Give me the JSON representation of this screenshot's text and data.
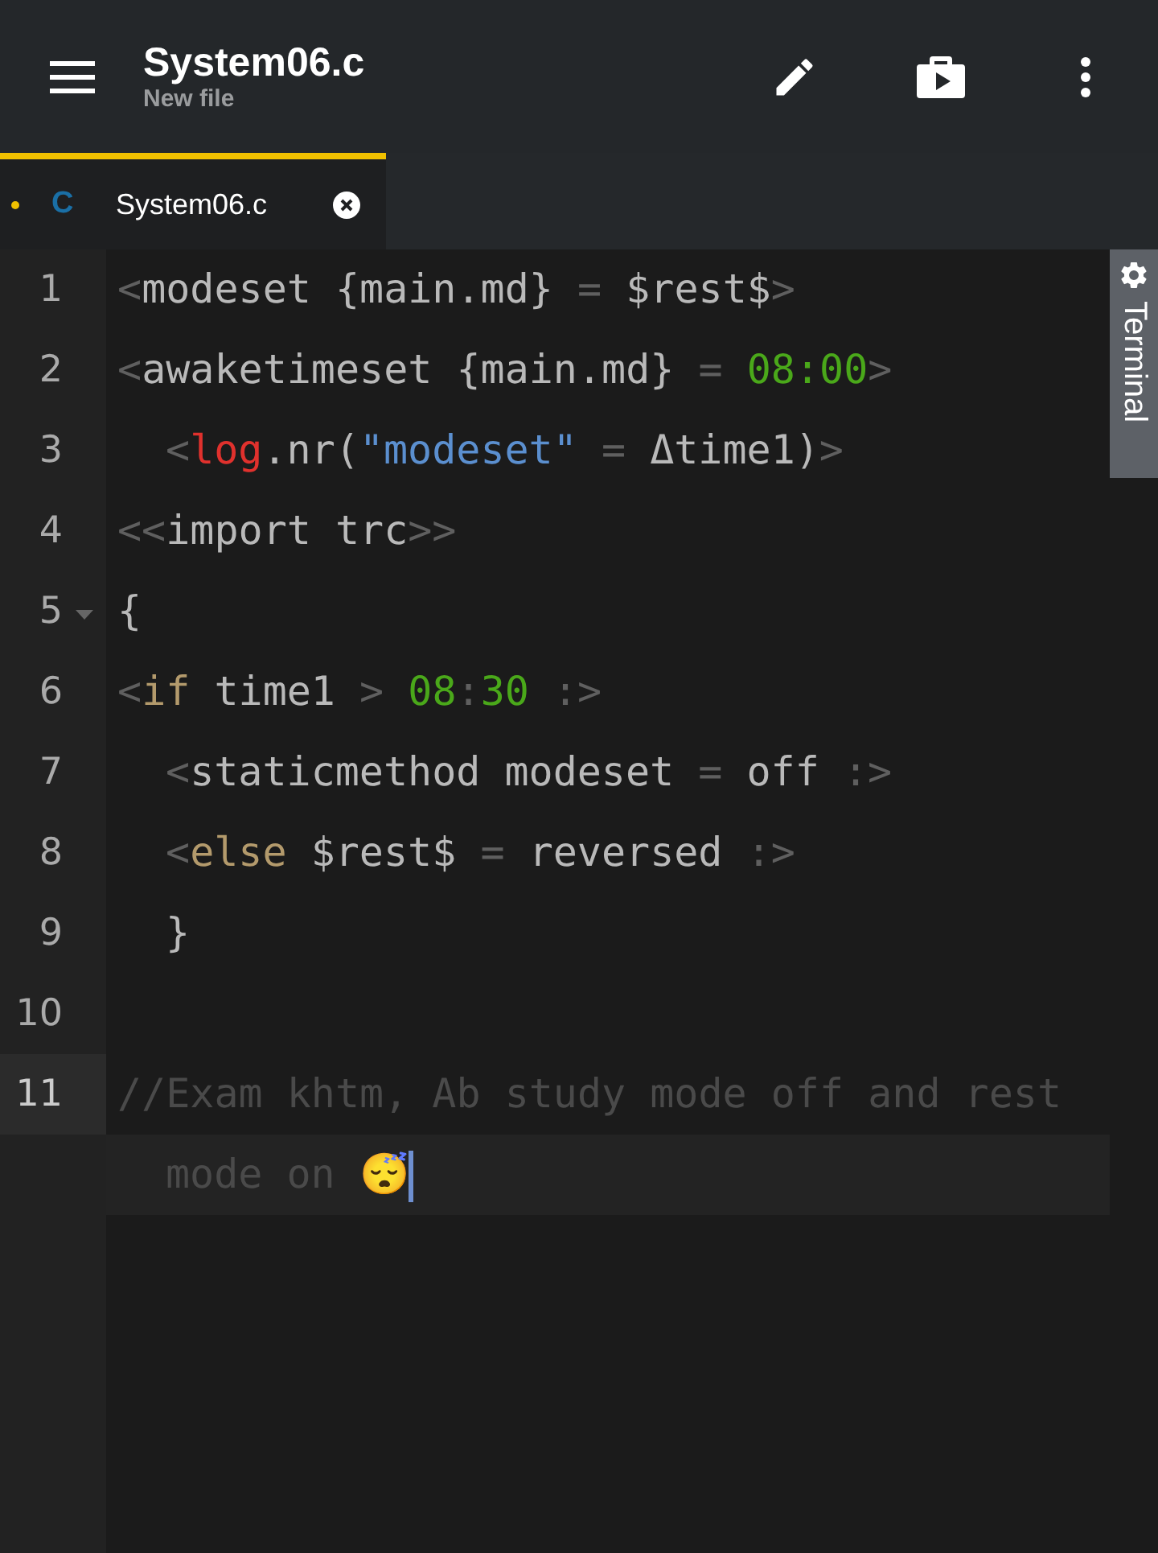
{
  "app_bar": {
    "title": "System06.c",
    "subtitle": "New file"
  },
  "tabs": [
    {
      "lang_badge": "C",
      "label": "System06.c",
      "selected": true,
      "modified": true
    }
  ],
  "side_panel": {
    "label": "Terminal"
  },
  "editor": {
    "lines": [
      {
        "number": "1",
        "indented": false,
        "foldable": false,
        "current": false,
        "tokens": [
          {
            "kind": "punct",
            "text": "<"
          },
          {
            "kind": "plain",
            "text": "modeset {main.md} "
          },
          {
            "kind": "punct",
            "text": "="
          },
          {
            "kind": "plain",
            "text": " $rest$"
          },
          {
            "kind": "punct",
            "text": ">"
          }
        ]
      },
      {
        "number": "2",
        "indented": false,
        "foldable": false,
        "current": false,
        "tokens": [
          {
            "kind": "punct",
            "text": "<"
          },
          {
            "kind": "plain",
            "text": "awaketimeset {main.md} "
          },
          {
            "kind": "punct",
            "text": "= "
          },
          {
            "kind": "number",
            "text": "08:00"
          },
          {
            "kind": "punct",
            "text": ">"
          }
        ]
      },
      {
        "number": "3",
        "indented": true,
        "foldable": false,
        "current": false,
        "tokens": [
          {
            "kind": "punct",
            "text": "<"
          },
          {
            "kind": "builtin",
            "text": "log"
          },
          {
            "kind": "plain",
            "text": ".nr("
          },
          {
            "kind": "string",
            "text": "\"modeset\""
          },
          {
            "kind": "punct",
            "text": " = "
          },
          {
            "kind": "plain",
            "text": "Δtime1)"
          },
          {
            "kind": "punct",
            "text": ">"
          }
        ]
      },
      {
        "number": "4",
        "indented": false,
        "foldable": false,
        "current": false,
        "tokens": [
          {
            "kind": "punct",
            "text": "<<"
          },
          {
            "kind": "plain",
            "text": "import trc"
          },
          {
            "kind": "punct",
            "text": ">>"
          }
        ]
      },
      {
        "number": "5",
        "indented": false,
        "foldable": true,
        "current": false,
        "tokens": [
          {
            "kind": "plain",
            "text": "{"
          }
        ]
      },
      {
        "number": "6",
        "indented": false,
        "foldable": false,
        "current": false,
        "tokens": [
          {
            "kind": "punct",
            "text": "<"
          },
          {
            "kind": "keyword",
            "text": "if"
          },
          {
            "kind": "plain",
            "text": " time1"
          },
          {
            "kind": "punct",
            "text": " > "
          },
          {
            "kind": "number",
            "text": "08"
          },
          {
            "kind": "punct",
            "text": ":"
          },
          {
            "kind": "number",
            "text": "30"
          },
          {
            "kind": "punct",
            "text": " :>"
          }
        ]
      },
      {
        "number": "7",
        "indented": true,
        "foldable": false,
        "current": false,
        "tokens": [
          {
            "kind": "punct",
            "text": "<"
          },
          {
            "kind": "plain",
            "text": "staticmethod modeset "
          },
          {
            "kind": "punct",
            "text": "="
          },
          {
            "kind": "plain",
            "text": " off "
          },
          {
            "kind": "punct",
            "text": ":>"
          }
        ]
      },
      {
        "number": "8",
        "indented": true,
        "foldable": false,
        "current": false,
        "tokens": [
          {
            "kind": "punct",
            "text": "<"
          },
          {
            "kind": "keyword",
            "text": "else"
          },
          {
            "kind": "plain",
            "text": " $rest$ "
          },
          {
            "kind": "punct",
            "text": "="
          },
          {
            "kind": "plain",
            "text": " reversed "
          },
          {
            "kind": "punct",
            "text": ":>"
          }
        ]
      },
      {
        "number": "9",
        "indented": true,
        "foldable": false,
        "current": false,
        "tokens": [
          {
            "kind": "plain",
            "text": "}"
          }
        ]
      },
      {
        "number": "10",
        "foldable": false,
        "current": false
      },
      {
        "number": "11",
        "indented": false,
        "foldable": false,
        "current": true,
        "tokens": [
          {
            "kind": "comment",
            "text": "//Exam khtm, Ab study mode off and rest mode on 😴"
          }
        ]
      }
    ]
  }
}
